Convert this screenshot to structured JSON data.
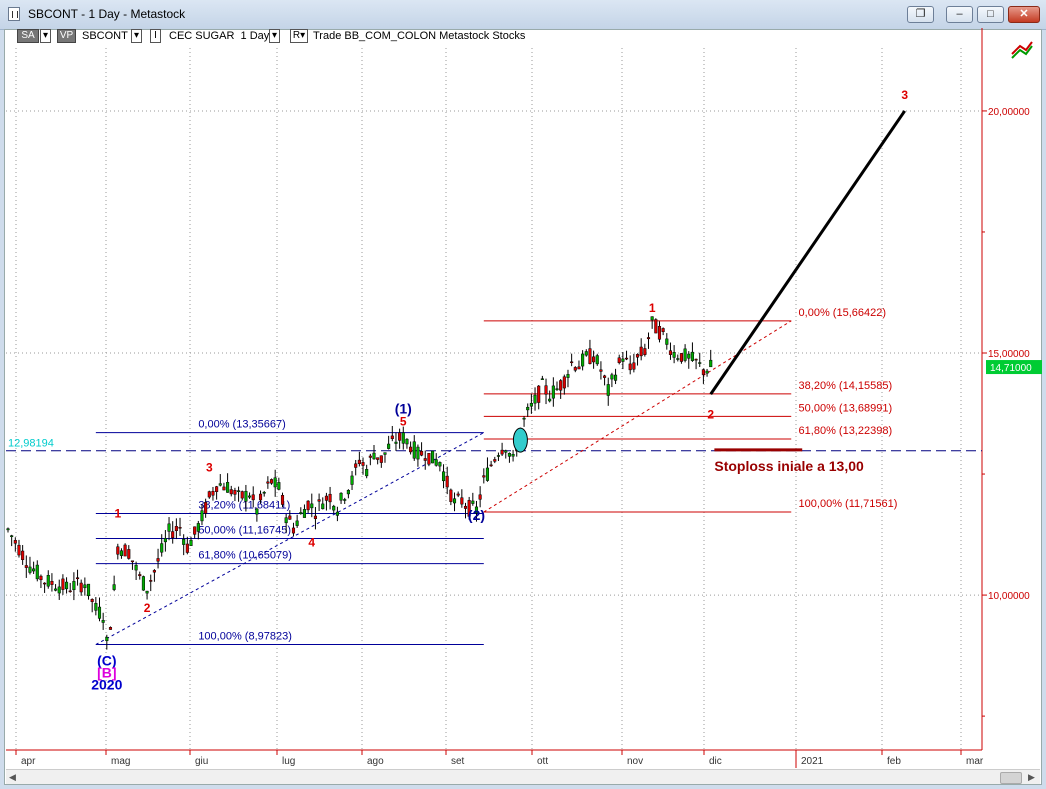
{
  "window": {
    "title": "SBCONT - 1 Day - Metastock"
  },
  "toolbar": {
    "sa": "SA",
    "vp": "VP",
    "symbol": "SBCONT",
    "i_label": "I",
    "security_name": "CEC SUGAR",
    "period": "1 Day",
    "r_label": "R",
    "trade_text": "Trade  BB_COM_COLON  Metastock  Stocks"
  },
  "chart_data": {
    "type": "candlestick",
    "x_tick_labels": [
      "apr",
      "mag",
      "giu",
      "lug",
      "ago",
      "set",
      "ott",
      "nov",
      "dic",
      "2021",
      "feb",
      "mar"
    ],
    "y_tick_labels": [
      "10,00000",
      "15,00000",
      "20,00000"
    ],
    "y_ticks": [
      10,
      15,
      20
    ],
    "ylim": [
      6.8,
      21.3
    ],
    "last_price_label": "14,71000",
    "last_price": 14.71,
    "price_path": [
      [
        0,
        11.35
      ],
      [
        6,
        10.6
      ],
      [
        10,
        10.3
      ],
      [
        16,
        10.15
      ],
      [
        21,
        10.25
      ],
      [
        24,
        9.7
      ],
      [
        26,
        9.6
      ],
      [
        27,
        9.0
      ],
      [
        28,
        9.45
      ],
      [
        29,
        10.1
      ],
      [
        30,
        11.0
      ],
      [
        33,
        10.9
      ],
      [
        36,
        10.35
      ],
      [
        38,
        10.15
      ],
      [
        40,
        10.5
      ],
      [
        42,
        10.9
      ],
      [
        44,
        11.3
      ],
      [
        47,
        11.4
      ],
      [
        49,
        11.0
      ],
      [
        51,
        11.25
      ],
      [
        53,
        11.6
      ],
      [
        55,
        12.0
      ],
      [
        57,
        12.3
      ],
      [
        60,
        12.25
      ],
      [
        63,
        12.0
      ],
      [
        66,
        12.1
      ],
      [
        68,
        11.75
      ],
      [
        70,
        12.1
      ],
      [
        72,
        12.35
      ],
      [
        74,
        12.2
      ],
      [
        76,
        11.65
      ],
      [
        78,
        11.4
      ],
      [
        80,
        11.65
      ],
      [
        82,
        11.9
      ],
      [
        84,
        11.75
      ],
      [
        86,
        11.95
      ],
      [
        88,
        12.05
      ],
      [
        90,
        11.8
      ],
      [
        92,
        12.1
      ],
      [
        94,
        12.35
      ],
      [
        96,
        12.8
      ],
      [
        98,
        12.6
      ],
      [
        100,
        12.95
      ],
      [
        102,
        12.8
      ],
      [
        104,
        13.05
      ],
      [
        106,
        13.2
      ],
      [
        108,
        13.25
      ],
      [
        110,
        13.1
      ],
      [
        112,
        12.9
      ],
      [
        114,
        12.95
      ],
      [
        116,
        12.8
      ],
      [
        118,
        12.75
      ],
      [
        120,
        12.3
      ],
      [
        122,
        11.9
      ],
      [
        124,
        11.95
      ],
      [
        126,
        11.8
      ],
      [
        128,
        11.75
      ],
      [
        130,
        12.35
      ],
      [
        132,
        12.7
      ],
      [
        134,
        13.0
      ],
      [
        136,
        13.1
      ],
      [
        138,
        12.75
      ],
      [
        140,
        13.45
      ],
      [
        142,
        13.75
      ],
      [
        144,
        14.0
      ],
      [
        146,
        14.3
      ],
      [
        148,
        14.15
      ],
      [
        150,
        14.25
      ],
      [
        152,
        14.45
      ],
      [
        154,
        14.8
      ],
      [
        156,
        14.75
      ],
      [
        158,
        14.9
      ],
      [
        160,
        14.95
      ],
      [
        162,
        14.65
      ],
      [
        164,
        14.2
      ],
      [
        166,
        14.6
      ],
      [
        168,
        14.95
      ],
      [
        170,
        14.65
      ],
      [
        172,
        14.9
      ],
      [
        174,
        15.05
      ],
      [
        176,
        15.6
      ],
      [
        178,
        15.45
      ],
      [
        180,
        15.25
      ],
      [
        182,
        15.0
      ],
      [
        184,
        14.95
      ],
      [
        186,
        14.9
      ],
      [
        188,
        14.8
      ],
      [
        190,
        14.65
      ],
      [
        192,
        14.71
      ]
    ],
    "waves": [
      {
        "text": "(C)",
        "x": 27,
        "y": 8.55,
        "color": "#0000cc"
      },
      {
        "text": "[B]",
        "x": 27,
        "y": 8.3,
        "color": "#dd00dd"
      },
      {
        "text": "2020",
        "x": 27,
        "y": 8.05,
        "color": "#0000cc"
      },
      {
        "text": "1",
        "x": 30,
        "y": 11.6,
        "color": "#dd0000"
      },
      {
        "text": "2",
        "x": 38,
        "y": 9.65,
        "color": "#dd0000"
      },
      {
        "text": "3",
        "x": 55,
        "y": 12.55,
        "color": "#dd0000"
      },
      {
        "text": "4",
        "x": 83,
        "y": 11.0,
        "color": "#dd0000"
      },
      {
        "text": "5",
        "x": 108,
        "y": 13.5,
        "color": "#dd0000"
      },
      {
        "text": "(1)",
        "x": 108,
        "y": 13.75,
        "color": "#000099"
      },
      {
        "text": "(2)",
        "x": 128,
        "y": 11.55,
        "color": "#000099"
      },
      {
        "text": "1",
        "x": 176,
        "y": 15.85,
        "color": "#dd0000"
      },
      {
        "text": "2",
        "x": 192,
        "y": 13.65,
        "color": "#dd0000"
      },
      {
        "text": "3",
        "x": 245,
        "y": 20.25,
        "color": "#dd0000"
      }
    ],
    "retracements": [
      {
        "color": "#000099",
        "x0": 24,
        "x1": 130,
        "label_x": 52,
        "levels": [
          {
            "label": "0,00% (13,35667)",
            "value": 13.35667
          },
          {
            "label": "38,20% (11,68411)",
            "value": 11.68411
          },
          {
            "label": "50,00% (11,16745)",
            "value": 11.16745
          },
          {
            "label": "61,80% (10,65079)",
            "value": 10.65079
          },
          {
            "label": "100,00% (8,97823)",
            "value": 8.97823
          }
        ]
      },
      {
        "color": "#cc0000",
        "x0": 130,
        "x1": 214,
        "label_x": 216,
        "levels": [
          {
            "label": "0,00% (15,66422)",
            "value": 15.66422
          },
          {
            "label": "38,20% (14,15585)",
            "value": 14.15585
          },
          {
            "label": "50,00% (13,68991)",
            "value": 13.68991
          },
          {
            "label": "61,80% (13,22398)",
            "value": 13.22398
          },
          {
            "label": "100,00% (11,71561)",
            "value": 11.71561
          }
        ]
      }
    ],
    "trendlines": [
      {
        "x0": 24,
        "y0": 8.97823,
        "x1": 130,
        "y1": 13.35667,
        "color": "#000099",
        "dash": true
      },
      {
        "x0": 130,
        "y0": 11.71561,
        "x1": 214,
        "y1": 15.66422,
        "color": "#cc0000",
        "dash": true
      }
    ],
    "projection": [
      [
        192,
        14.15
      ],
      [
        245,
        20.0
      ]
    ],
    "hline_value_label": "12,98194",
    "hline_value": 12.98194,
    "stoploss": {
      "label": "Stoploss iniale a 13,00",
      "value": 13.0,
      "x0": 193,
      "x1": 217
    },
    "breakout_marker": {
      "x": 140,
      "y": 13.2
    }
  }
}
